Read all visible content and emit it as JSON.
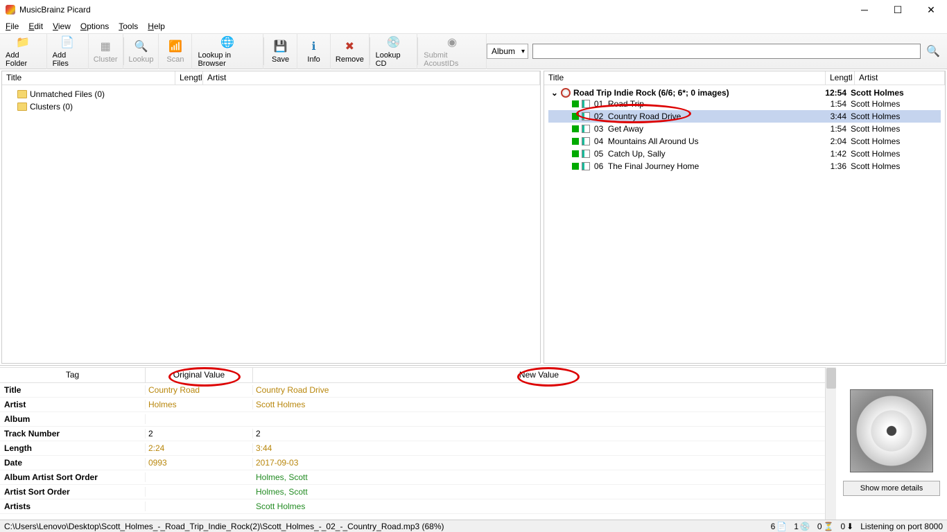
{
  "app": {
    "title": "MusicBrainz Picard"
  },
  "menu": {
    "file": "File",
    "edit": "Edit",
    "view": "View",
    "options": "Options",
    "tools": "Tools",
    "help": "Help"
  },
  "toolbar": {
    "add_folder": "Add Folder",
    "add_files": "Add Files",
    "cluster": "Cluster",
    "lookup": "Lookup",
    "scan": "Scan",
    "lookup_browser": "Lookup in Browser",
    "save": "Save",
    "info": "Info",
    "remove": "Remove",
    "lookup_cd": "Lookup CD",
    "submit_acoustids": "Submit AcoustIDs"
  },
  "search": {
    "type": "Album",
    "value": ""
  },
  "left": {
    "headers": {
      "title": "Title",
      "length": "Lengtl",
      "artist": "Artist"
    },
    "unmatched": "Unmatched Files (0)",
    "clusters": "Clusters (0)"
  },
  "right": {
    "headers": {
      "title": "Title",
      "length": "Lengtl",
      "artist": "Artist"
    },
    "album": {
      "title": "Road Trip Indie Rock (6/6; 6*; 0 images)",
      "length": "12:54",
      "artist": "Scott Holmes"
    },
    "tracks": [
      {
        "num": "01",
        "title": "Road Trip",
        "length": "1:54",
        "artist": "Scott Holmes"
      },
      {
        "num": "02",
        "title": "Country Road Drive",
        "length": "3:44",
        "artist": "Scott Holmes"
      },
      {
        "num": "03",
        "title": "Get Away",
        "length": "1:54",
        "artist": "Scott Holmes"
      },
      {
        "num": "04",
        "title": "Mountains All Around Us",
        "length": "2:04",
        "artist": "Scott Holmes"
      },
      {
        "num": "05",
        "title": "Catch Up, Sally",
        "length": "1:42",
        "artist": "Scott Holmes"
      },
      {
        "num": "06",
        "title": "The Final Journey Home",
        "length": "1:36",
        "artist": "Scott Holmes"
      }
    ]
  },
  "tags": {
    "headers": {
      "tag": "Tag",
      "orig": "Original Value",
      "new": "New Value"
    },
    "rows": [
      {
        "tag": "Title",
        "orig": "Country Road",
        "new": "Country Road Drive",
        "oc": "orange",
        "nc": "orange"
      },
      {
        "tag": "Artist",
        "orig": "Holmes",
        "new": "Scott Holmes",
        "oc": "orange",
        "nc": "orange"
      },
      {
        "tag": "Album",
        "orig": "",
        "new": "",
        "oc": "",
        "nc": ""
      },
      {
        "tag": "Track Number",
        "orig": "2",
        "new": "2",
        "oc": "",
        "nc": ""
      },
      {
        "tag": "Length",
        "orig": "2:24",
        "new": "3:44",
        "oc": "orange",
        "nc": "orange"
      },
      {
        "tag": "Date",
        "orig": "0993",
        "new": "2017-09-03",
        "oc": "orange",
        "nc": "orange"
      },
      {
        "tag": "Album Artist Sort Order",
        "orig": "",
        "new": "Holmes, Scott",
        "oc": "",
        "nc": "green"
      },
      {
        "tag": "Artist Sort Order",
        "orig": "",
        "new": "Holmes, Scott",
        "oc": "",
        "nc": "green"
      },
      {
        "tag": "Artists",
        "orig": "",
        "new": "Scott Holmes",
        "oc": "",
        "nc": "green"
      }
    ]
  },
  "art": {
    "button": "Show more details"
  },
  "status": {
    "path": "C:\\Users\\Lenovo\\Desktop\\Scott_Holmes_-_Road_Trip_Indie_Rock(2)\\Scott_Holmes_-_02_-_Country_Road.mp3 (68%)",
    "c1": "6",
    "c2": "1",
    "c3": "0",
    "c4": "0",
    "listening": "Listening on port 8000"
  }
}
